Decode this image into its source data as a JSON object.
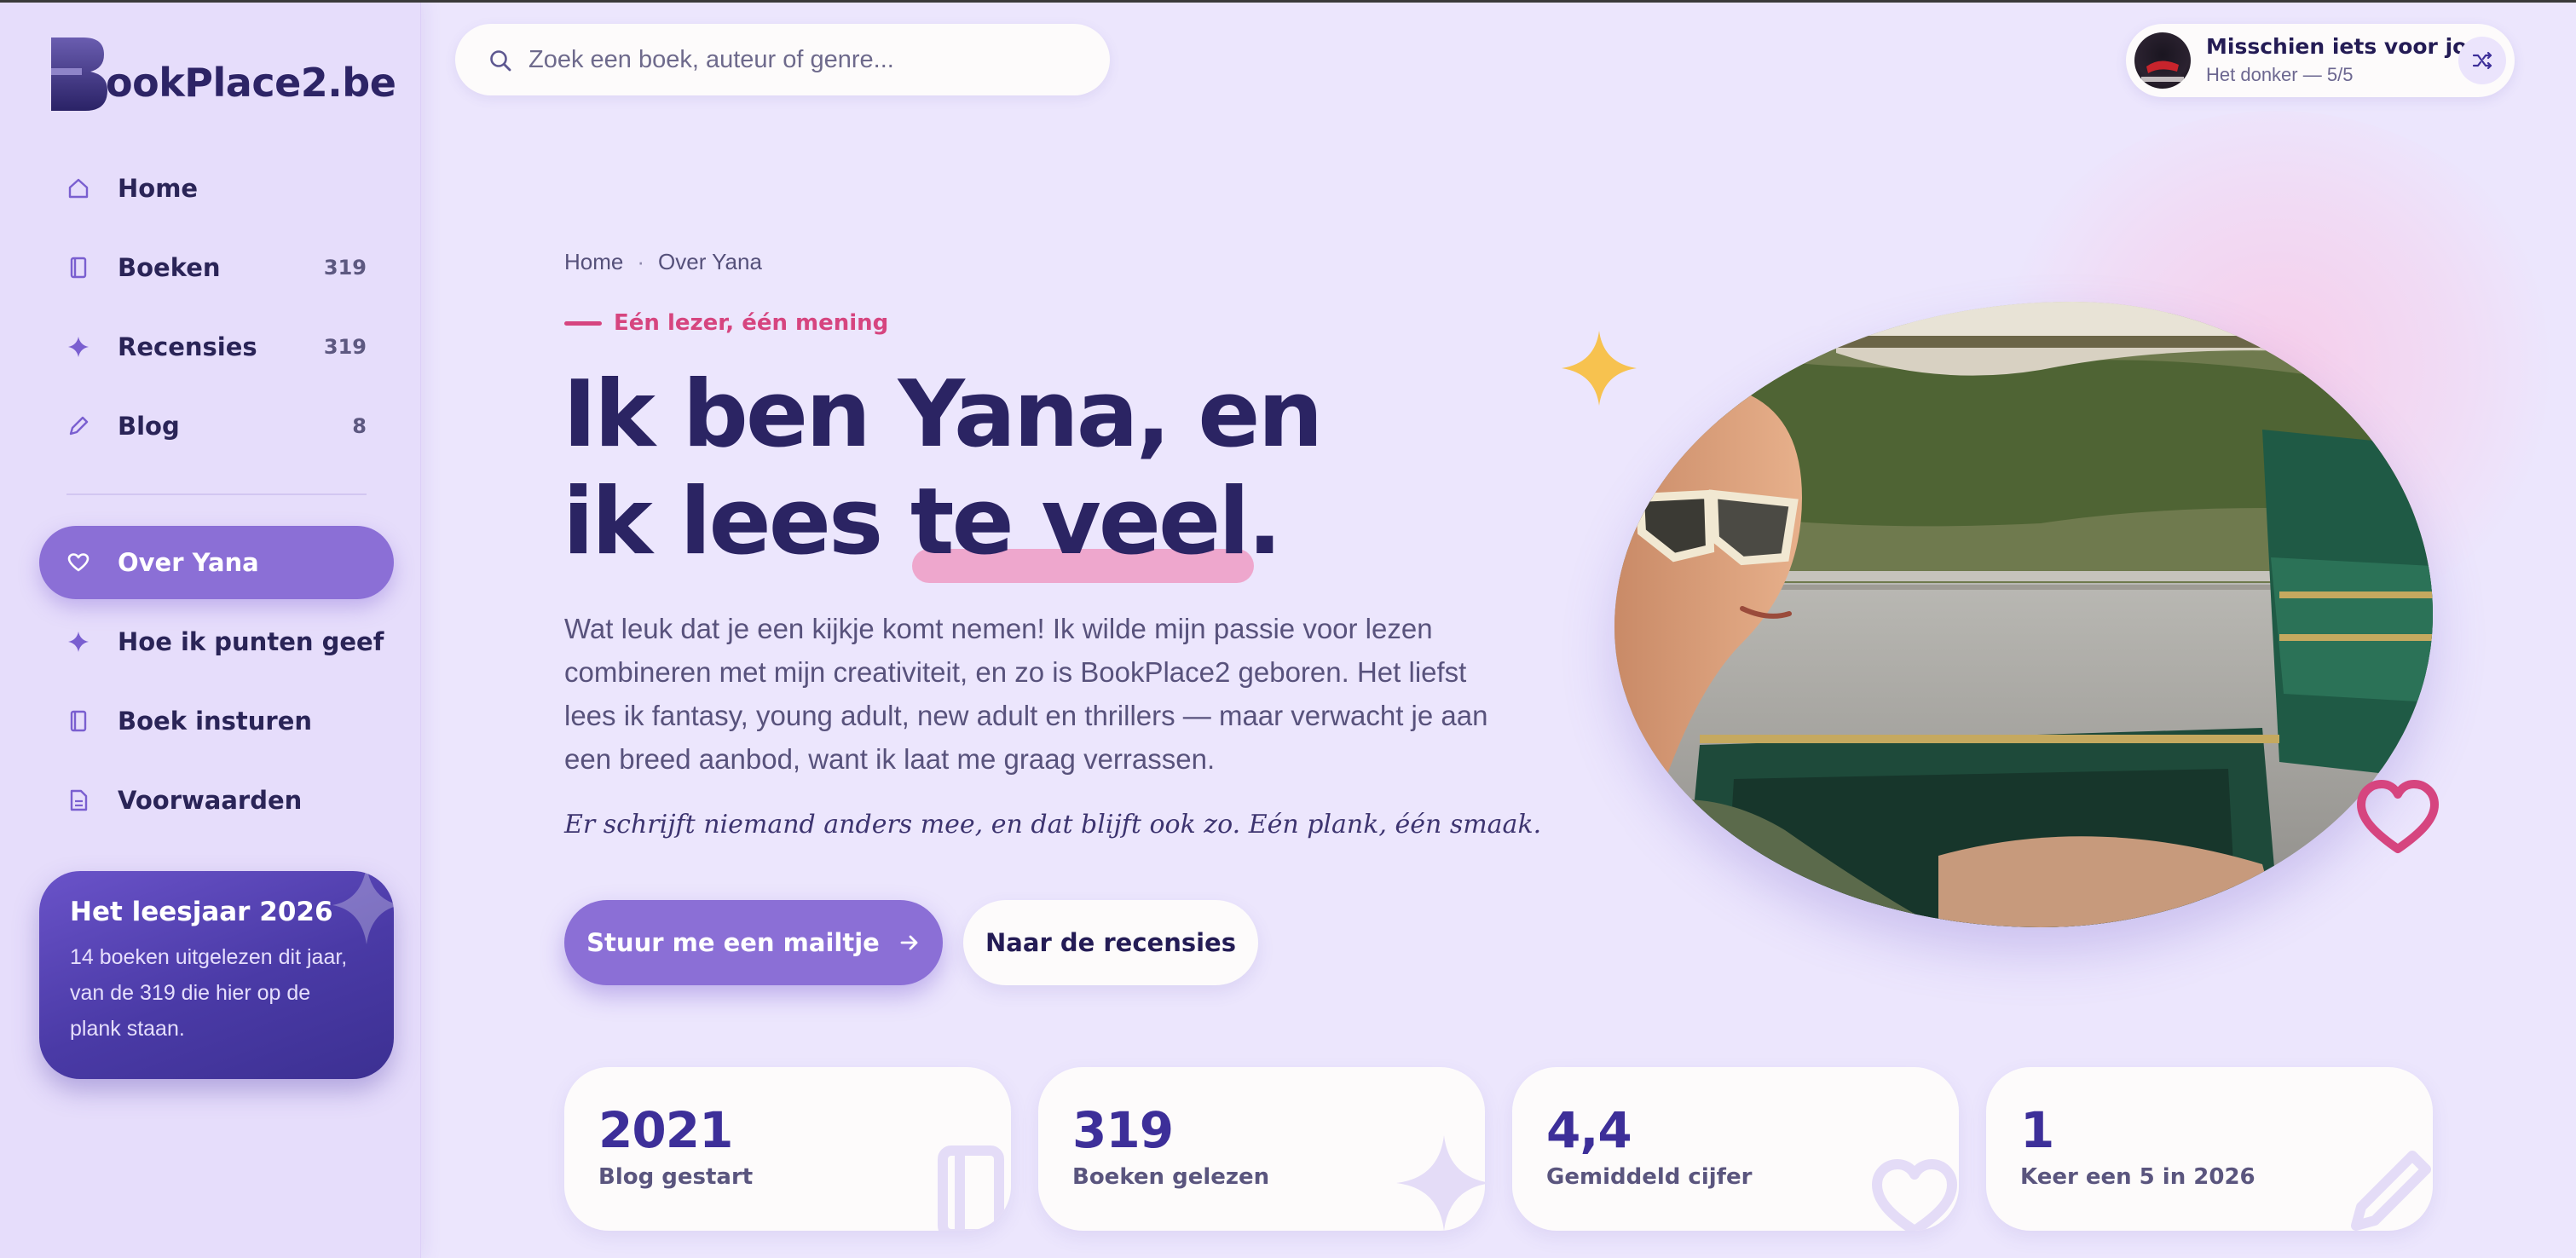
{
  "brand": {
    "logo_text": "ookPlace2.be",
    "logo_letter": "B"
  },
  "sidebar": {
    "items": [
      {
        "label": "Home",
        "count": "",
        "icon": "home-icon"
      },
      {
        "label": "Boeken",
        "count": "319",
        "icon": "book-icon"
      },
      {
        "label": "Recensies",
        "count": "319",
        "icon": "sparkle-icon"
      },
      {
        "label": "Blog",
        "count": "8",
        "icon": "pencil-icon"
      },
      {
        "label": "Over Yana",
        "count": "",
        "icon": "heart-icon",
        "active": true
      },
      {
        "label": "Hoe ik punten geef",
        "count": "",
        "icon": "sparkle-icon"
      },
      {
        "label": "Boek insturen",
        "count": "",
        "icon": "book-icon"
      },
      {
        "label": "Voorwaarden",
        "count": "",
        "icon": "document-icon"
      }
    ],
    "year_card": {
      "title": "Het leesjaar 2026",
      "text": "14 boeken uitgelezen dit jaar, van de 319 die hier op de plank staan."
    }
  },
  "search": {
    "placeholder": "Zoek een boek, auteur of genre...",
    "value": ""
  },
  "suggestion": {
    "title": "Misschien iets voor jou",
    "subtitle": "Het donker — 5/5",
    "icon": "shuffle-icon"
  },
  "breadcrumb": {
    "home": "Home",
    "separator": "·",
    "current": "Over Yana"
  },
  "hero": {
    "eyebrow": "Eén lezer, één mening",
    "title_line1": "Ik ben Yana, en",
    "title_line2_start": "ik lees ",
    "title_line2_highlight": "te veel",
    "title_line2_end": ".",
    "intro": "Wat leuk dat je een kijkje komt nemen! Ik wilde mijn passie voor lezen combineren met mijn creativiteit, en zo is BookPlace2 geboren. Het liefst lees ik fantasy, young adult, new adult en thrillers — maar verwacht je aan een breed aanbod, want ik laat me graag verrassen.",
    "quote": "Er schrijft niemand anders mee, en dat blijft ook zo. Eén plank, één smaak.",
    "primary_button": "Stuur me een mailtje",
    "secondary_button": "Naar de recensies"
  },
  "stats": [
    {
      "value": "2021",
      "label": "Blog gestart",
      "icon": "book-icon"
    },
    {
      "value": "319",
      "label": "Boeken gelezen",
      "icon": "sparkle-icon"
    },
    {
      "value": "4,4",
      "label": "Gemiddeld cijfer",
      "icon": "heart-icon"
    },
    {
      "value": "1",
      "label": "Keer een 5 in 2026",
      "icon": "pencil-icon"
    }
  ],
  "colors": {
    "accent": "#8b6fd6",
    "pink": "#d6457f",
    "navy": "#2b2463",
    "background": "#ece6fd",
    "gold": "#f7c24f"
  }
}
